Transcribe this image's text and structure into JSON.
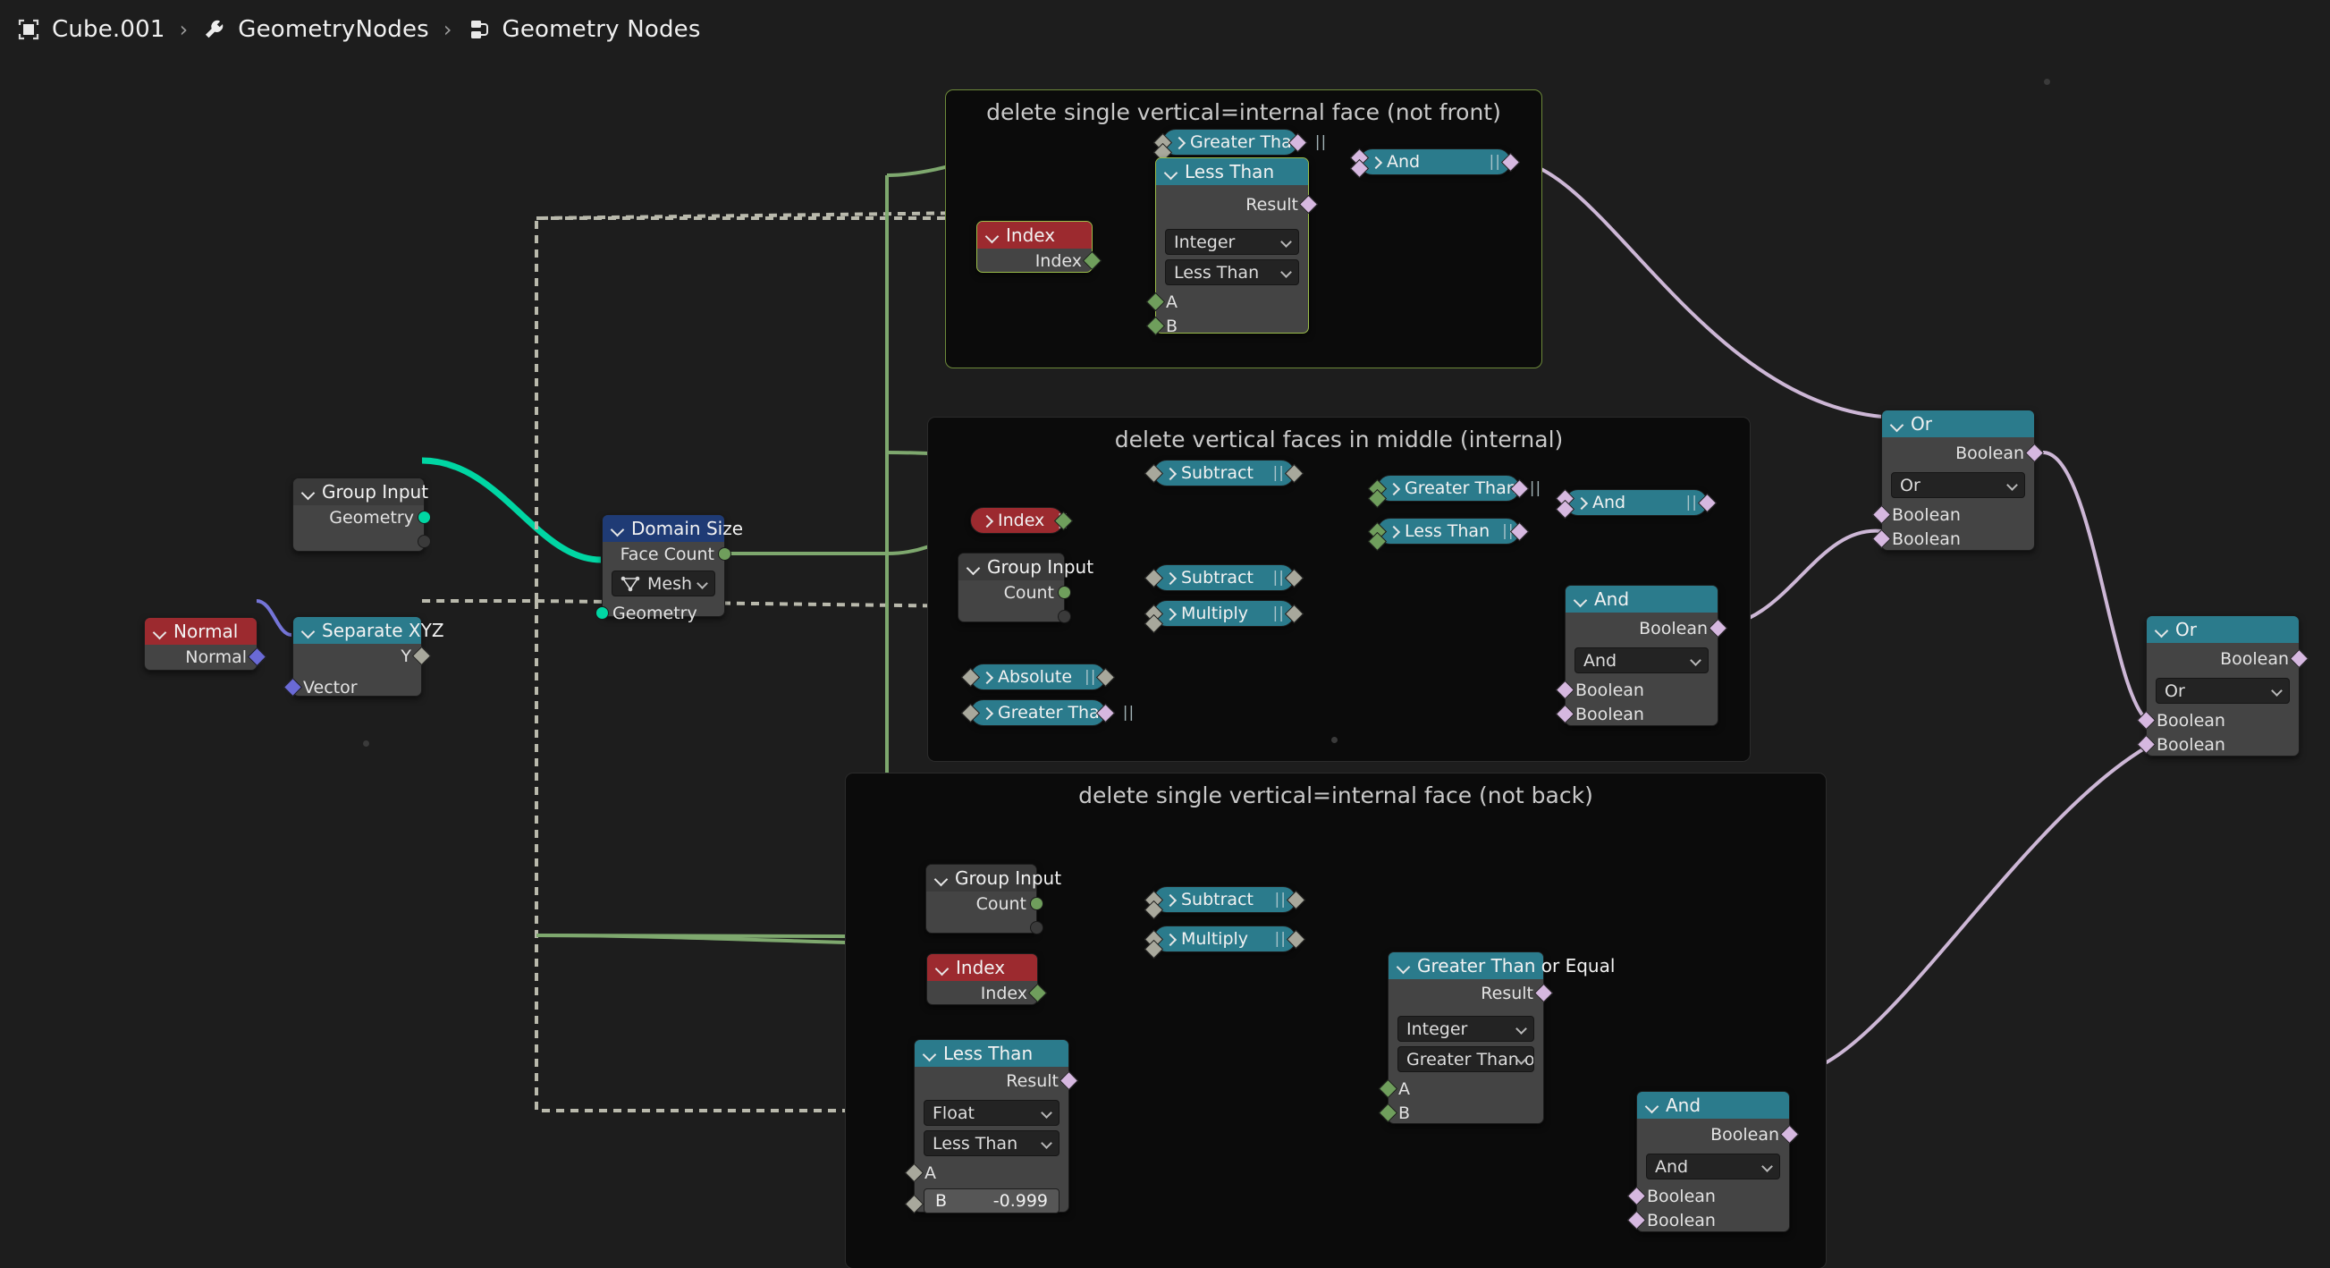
{
  "breadcrumb": {
    "items": [
      {
        "icon": "object-icon",
        "label": "Cube.001"
      },
      {
        "icon": "modifier-wrench-icon",
        "label": "GeometryNodes"
      },
      {
        "icon": "geometry-nodes-icon",
        "label": "Geometry Nodes"
      }
    ],
    "separator": "›"
  },
  "colors": {
    "header_teal": "#2b7b8c",
    "header_red": "#9c2a2f",
    "header_blue": "#1f3b75",
    "node_body": "#444444",
    "frame_bg": "#0b0b0b",
    "canvas_bg": "#1d1d1d",
    "socket_geometry": "#00d6a3",
    "socket_integer": "#6f9e5c",
    "socket_boolean": "#d6b8e0",
    "socket_vector": "#6a6ad6",
    "socket_grey": "#a8a89c",
    "selection_outline": "#9bbd4a"
  },
  "frames": [
    {
      "id": "frame-not-front",
      "title": "delete single vertical=internal face (not front)",
      "selected": true
    },
    {
      "id": "frame-middle",
      "title": "delete vertical faces in middle (internal)",
      "selected": false
    },
    {
      "id": "frame-not-back",
      "title": "delete single vertical=internal face (not back)",
      "selected": false
    }
  ],
  "nodes": {
    "group_input_geometry": {
      "header": "Group Input",
      "outputs": [
        {
          "label": "Geometry",
          "type": "geometry"
        },
        {
          "label": "",
          "type": "hollow"
        }
      ]
    },
    "domain_size": {
      "header": "Domain Size",
      "outputs": [
        {
          "label": "Face Count",
          "type": "integer"
        }
      ],
      "component": "Mesh",
      "inputs": [
        {
          "label": "Geometry",
          "type": "geometry"
        }
      ]
    },
    "normal": {
      "header": "Normal",
      "outputs": [
        {
          "label": "Normal",
          "type": "vector"
        }
      ]
    },
    "separate_xyz": {
      "header": "Separate XYZ",
      "outputs": [
        {
          "label": "Y",
          "type": "grey"
        }
      ],
      "inputs": [
        {
          "label": "Vector",
          "type": "vector"
        }
      ]
    },
    "top_index": {
      "header": "Index",
      "outputs": [
        {
          "label": "Index",
          "type": "integer"
        }
      ]
    },
    "top_greater_than": {
      "label": "Greater Than",
      "collapsed": true
    },
    "top_and": {
      "label": "And",
      "collapsed": true
    },
    "top_less_than": {
      "header": "Less Than",
      "outputs": [
        {
          "label": "Result",
          "type": "boolean"
        }
      ],
      "data_type": "Integer",
      "operation": "Less Than",
      "inputs": [
        {
          "label": "A",
          "type": "integer"
        },
        {
          "label": "B",
          "type": "integer"
        }
      ]
    },
    "mid_index": {
      "label": "Index",
      "collapsed": true
    },
    "mid_group_input": {
      "header": "Group Input",
      "outputs": [
        {
          "label": "Count",
          "type": "integer"
        },
        {
          "label": "",
          "type": "hollow"
        }
      ]
    },
    "mid_subtract_1": {
      "label": "Subtract",
      "collapsed": true
    },
    "mid_subtract_2": {
      "label": "Subtract",
      "collapsed": true
    },
    "mid_multiply": {
      "label": "Multiply",
      "collapsed": true
    },
    "mid_greater_than": {
      "label": "Greater Than",
      "collapsed": true
    },
    "mid_less_than": {
      "label": "Less Than",
      "collapsed": true
    },
    "mid_and_collapsed": {
      "label": "And",
      "collapsed": true
    },
    "mid_absolute": {
      "label": "Absolute",
      "collapsed": true
    },
    "mid_greater_than_2": {
      "label": "Greater Than",
      "collapsed": true
    },
    "mid_and": {
      "header": "And",
      "outputs": [
        {
          "label": "Boolean",
          "type": "boolean"
        }
      ],
      "operation": "And",
      "inputs": [
        {
          "label": "Boolean",
          "type": "boolean"
        },
        {
          "label": "Boolean",
          "type": "boolean"
        }
      ]
    },
    "or_top": {
      "header": "Or",
      "outputs": [
        {
          "label": "Boolean",
          "type": "boolean"
        }
      ],
      "operation": "Or",
      "inputs": [
        {
          "label": "Boolean",
          "type": "boolean"
        },
        {
          "label": "Boolean",
          "type": "boolean"
        }
      ]
    },
    "or_right": {
      "header": "Or",
      "outputs": [
        {
          "label": "Boolean",
          "type": "boolean"
        }
      ],
      "operation": "Or",
      "inputs": [
        {
          "label": "Boolean",
          "type": "boolean"
        },
        {
          "label": "Boolean",
          "type": "boolean"
        }
      ]
    },
    "bot_group_input": {
      "header": "Group Input",
      "outputs": [
        {
          "label": "Count",
          "type": "integer"
        },
        {
          "label": "",
          "type": "hollow"
        }
      ]
    },
    "bot_subtract": {
      "label": "Subtract",
      "collapsed": true
    },
    "bot_multiply": {
      "label": "Multiply",
      "collapsed": true
    },
    "bot_index": {
      "header": "Index",
      "outputs": [
        {
          "label": "Index",
          "type": "integer"
        }
      ]
    },
    "bot_less_than": {
      "header": "Less Than",
      "outputs": [
        {
          "label": "Result",
          "type": "boolean"
        }
      ],
      "data_type": "Float",
      "operation": "Less Than",
      "inputs": [
        {
          "label": "A",
          "type": "grey"
        },
        {
          "label": "B",
          "type": "grey"
        }
      ],
      "b_value": "-0.999",
      "b_label": "B"
    },
    "bot_gte": {
      "header": "Greater Than or Equal",
      "outputs": [
        {
          "label": "Result",
          "type": "boolean"
        }
      ],
      "data_type": "Integer",
      "operation": "Greater Than or E...",
      "inputs": [
        {
          "label": "A",
          "type": "integer"
        },
        {
          "label": "B",
          "type": "integer"
        }
      ]
    },
    "bot_and": {
      "header": "And",
      "outputs": [
        {
          "label": "Boolean",
          "type": "boolean"
        }
      ],
      "operation": "And",
      "inputs": [
        {
          "label": "Boolean",
          "type": "boolean"
        },
        {
          "label": "Boolean",
          "type": "boolean"
        }
      ]
    }
  }
}
